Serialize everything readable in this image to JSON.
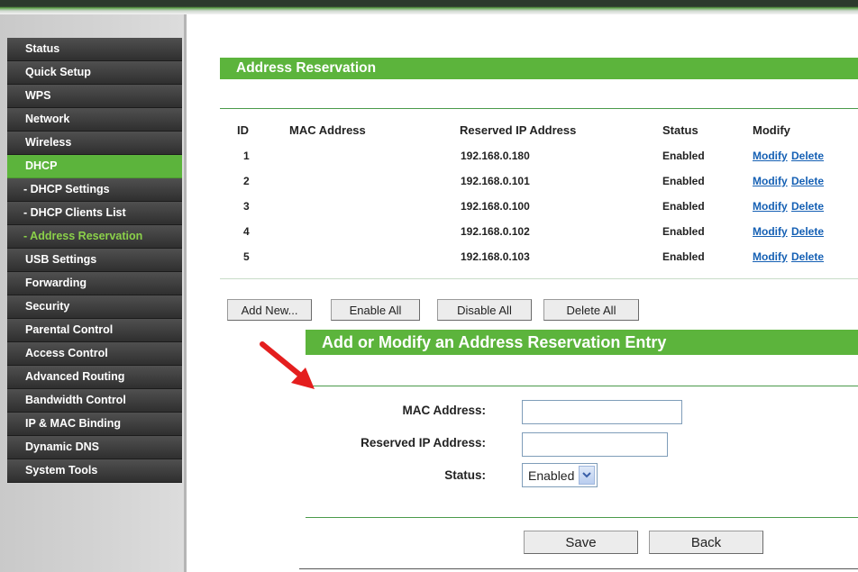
{
  "sidebar": {
    "items": [
      {
        "label": "Status"
      },
      {
        "label": "Quick Setup"
      },
      {
        "label": "WPS"
      },
      {
        "label": "Network"
      },
      {
        "label": "Wireless"
      },
      {
        "label": "DHCP"
      },
      {
        "label": "- DHCP Settings"
      },
      {
        "label": "- DHCP Clients List"
      },
      {
        "label": "- Address Reservation"
      },
      {
        "label": "USB Settings"
      },
      {
        "label": "Forwarding"
      },
      {
        "label": "Security"
      },
      {
        "label": "Parental Control"
      },
      {
        "label": "Access Control"
      },
      {
        "label": "Advanced Routing"
      },
      {
        "label": "Bandwidth Control"
      },
      {
        "label": "IP & MAC Binding"
      },
      {
        "label": "Dynamic DNS"
      },
      {
        "label": "System Tools"
      }
    ]
  },
  "main": {
    "title": "Address Reservation",
    "table": {
      "headers": [
        "ID",
        "MAC Address",
        "Reserved IP Address",
        "Status",
        "Modify"
      ],
      "rows": [
        {
          "id": "1",
          "mac": "",
          "ip": "192.168.0.180",
          "status": "Enabled",
          "modify": "Modify",
          "delete": "Delete"
        },
        {
          "id": "2",
          "mac": "",
          "ip": "192.168.0.101",
          "status": "Enabled",
          "modify": "Modify",
          "delete": "Delete"
        },
        {
          "id": "3",
          "mac": "",
          "ip": "192.168.0.100",
          "status": "Enabled",
          "modify": "Modify",
          "delete": "Delete"
        },
        {
          "id": "4",
          "mac": "",
          "ip": "192.168.0.102",
          "status": "Enabled",
          "modify": "Modify",
          "delete": "Delete"
        },
        {
          "id": "5",
          "mac": "",
          "ip": "192.168.0.103",
          "status": "Enabled",
          "modify": "Modify",
          "delete": "Delete"
        }
      ]
    },
    "buttons": {
      "add_new": "Add New...",
      "enable_all": "Enable All",
      "disable_all": "Disable All",
      "delete_all": "Delete All"
    }
  },
  "form": {
    "title": "Add or Modify an Address Reservation Entry",
    "mac_label": "MAC Address:",
    "mac_value": "",
    "ip_label": "Reserved IP Address:",
    "ip_value": "",
    "status_label": "Status:",
    "status_value": "Enabled",
    "save": "Save",
    "back": "Back"
  },
  "colors": {
    "accent_green": "#5cb43c",
    "menu_dark": "#3a3a3a",
    "link_blue": "#1560b4",
    "annotation_red": "#e41e1e"
  },
  "icons": {
    "annotation": "red-arrow-icon",
    "dropdown": "chevron-down-icon"
  }
}
